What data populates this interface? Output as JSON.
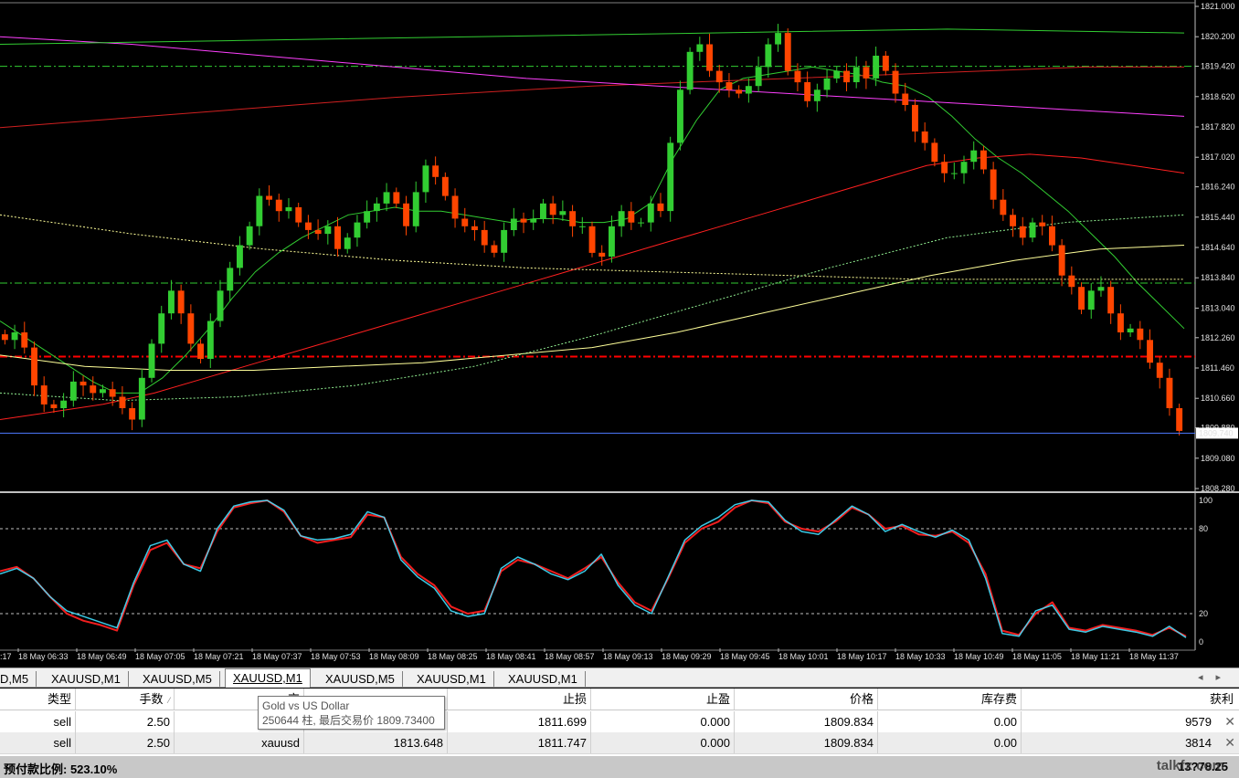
{
  "chart_data": [
    {
      "type": "candlestick",
      "symbol_hint": "XAUUSD,M1",
      "ylim": [
        1808.28,
        1821.0
      ],
      "y_ticks": [
        "1821.000",
        "1820.200",
        "1819.420",
        "1818.620",
        "1817.820",
        "1817.020",
        "1816.240",
        "1815.440",
        "1814.640",
        "1813.840",
        "1813.040",
        "1812.260",
        "1811.460",
        "1810.660",
        "1809.880",
        "1809.080",
        "1808.280"
      ],
      "x_ticks": [
        "18 May 06:33",
        "18 May 06:49",
        "18 May 07:05",
        "18 May 07:21",
        "18 May 07:37",
        "18 May 07:53",
        "18 May 08:09",
        "18 May 08:25",
        "18 May 08:41",
        "18 May 08:57",
        "18 May 09:13",
        "18 May 09:29",
        "18 May 09:45",
        "18 May 10:01",
        "18 May 10:17",
        "18 May 10:33",
        "18 May 10:49",
        "18 May 11:05",
        "18 May 11:21",
        "18 May 11:37"
      ],
      "x_tick_partial_left": ":17",
      "current_price": "1809.740",
      "close_path_approx": [
        1812.2,
        1812.4,
        1812.0,
        1811.0,
        1810.5,
        1810.4,
        1810.6,
        1811.1,
        1811.0,
        1810.8,
        1810.9,
        1810.7,
        1810.4,
        1810.1,
        1811.2,
        1812.1,
        1812.9,
        1813.5,
        1812.9,
        1812.1,
        1811.7,
        1812.7,
        1813.5,
        1814.1,
        1814.7,
        1815.2,
        1816.0,
        1815.9,
        1815.6,
        1815.7,
        1815.3,
        1815.1,
        1815.0,
        1815.2,
        1814.6,
        1814.9,
        1815.3,
        1815.6,
        1815.8,
        1816.1,
        1815.8,
        1815.2,
        1816.1,
        1816.8,
        1816.5,
        1816.0,
        1815.4,
        1815.2,
        1815.1,
        1814.7,
        1814.5,
        1815.1,
        1815.4,
        1815.3,
        1815.4,
        1815.8,
        1815.5,
        1815.6,
        1815.2,
        1815.2,
        1814.5,
        1814.4,
        1815.2,
        1815.6,
        1815.3,
        1815.3,
        1815.8,
        1815.6,
        1817.4,
        1818.8,
        1819.8,
        1820.0,
        1819.3,
        1819.0,
        1818.8,
        1818.7,
        1818.9,
        1819.4,
        1820.0,
        1820.3,
        1819.3,
        1819.0,
        1818.5,
        1818.8,
        1819.1,
        1819.3,
        1819.0,
        1819.4,
        1819.1,
        1819.7,
        1819.3,
        1818.7,
        1818.4,
        1817.7,
        1817.4,
        1816.9,
        1816.6,
        1816.6,
        1816.9,
        1817.2,
        1816.7,
        1815.9,
        1815.5,
        1815.2,
        1814.9,
        1815.3,
        1815.2,
        1814.7,
        1813.9,
        1813.6,
        1813.0,
        1813.5,
        1813.6,
        1812.9,
        1812.4,
        1812.5,
        1812.2,
        1811.6,
        1811.2,
        1810.4,
        1809.8
      ],
      "moving_averages": [
        {
          "color": "#32cd32",
          "style": "solid",
          "values": [
            1812.7,
            1812.3,
            1811.9,
            1811.5,
            1811.1,
            1810.8,
            1810.8,
            1811.2,
            1811.8,
            1812.5,
            1813.3,
            1814.0,
            1814.5,
            1814.9,
            1815.2,
            1815.5,
            1815.6,
            1815.7,
            1815.6,
            1815.6,
            1815.5,
            1815.4,
            1815.3,
            1815.4,
            1815.4,
            1815.3,
            1815.3,
            1815.4,
            1815.8,
            1817.0,
            1818.0,
            1818.8,
            1819.1,
            1819.2,
            1819.3,
            1819.4,
            1819.3,
            1819.2,
            1819.0,
            1818.9,
            1818.6,
            1818.1,
            1817.5,
            1817.0,
            1816.6,
            1816.1,
            1815.6,
            1815.0,
            1814.4,
            1813.7,
            1813.1,
            1812.5
          ]
        },
        {
          "color": "#ff2020",
          "style": "solid",
          "values": [
            1810.1,
            1810.3,
            1810.5,
            1810.8,
            1811.2,
            1811.6,
            1812.0,
            1812.4,
            1812.8,
            1813.2,
            1813.6,
            1814.0,
            1814.4,
            1814.8,
            1815.2,
            1815.6,
            1816.0,
            1816.4,
            1816.8,
            1817.0,
            1817.1,
            1817.0,
            1816.8,
            1816.6
          ]
        },
        {
          "color": "#d02020",
          "style": "solid",
          "values": [
            1817.8,
            1818.0,
            1818.2,
            1818.4,
            1818.6,
            1818.75,
            1818.9,
            1819.0,
            1819.1,
            1819.2,
            1819.3,
            1819.4,
            1819.4
          ]
        },
        {
          "color": "#ff40ff",
          "style": "solid",
          "values": [
            1820.2,
            1820.0,
            1819.7,
            1819.4,
            1819.1,
            1818.9,
            1818.7,
            1818.5,
            1818.3,
            1818.1
          ]
        },
        {
          "color": "#32cd32",
          "style": "solid",
          "values": [
            1820.0,
            1820.1,
            1820.2,
            1820.3,
            1820.4,
            1820.3
          ]
        },
        {
          "color": "#ffff99",
          "style": "solid",
          "values": [
            1811.8,
            1811.5,
            1811.4,
            1811.4,
            1811.5,
            1811.6,
            1811.8,
            1812.0,
            1812.4,
            1812.9,
            1813.4,
            1813.9,
            1814.3,
            1814.6,
            1814.7
          ]
        },
        {
          "color": "#ffff99",
          "style": "dotted",
          "values": [
            1815.5,
            1815.0,
            1814.6,
            1814.3,
            1814.1,
            1814.0,
            1813.9,
            1813.8,
            1813.8,
            1813.8
          ]
        },
        {
          "color": "#90ee90",
          "style": "dotted",
          "values": [
            1810.8,
            1810.6,
            1810.7,
            1811.0,
            1811.5,
            1812.3,
            1813.2,
            1814.1,
            1814.9,
            1815.3,
            1815.5
          ]
        }
      ],
      "levels": [
        {
          "price": 1819.42,
          "color": "#32cd32",
          "style": "dashdot"
        },
        {
          "price": 1813.7,
          "color": "#32cd32",
          "style": "dashdot"
        },
        {
          "price": 1811.76,
          "color": "#ff0000",
          "style": "dashdot"
        }
      ]
    },
    {
      "type": "line",
      "indicator": "stochastic",
      "ylim": [
        0,
        100
      ],
      "y_ticks": [
        "100",
        "80",
        "20",
        "0"
      ],
      "levels": [
        80,
        20
      ],
      "series": [
        {
          "color": "#ff2020",
          "values": [
            50,
            53,
            45,
            32,
            20,
            15,
            12,
            8,
            40,
            65,
            70,
            55,
            52,
            78,
            95,
            98,
            100,
            92,
            75,
            70,
            72,
            74,
            90,
            88,
            60,
            48,
            40,
            25,
            20,
            22,
            50,
            58,
            55,
            50,
            45,
            52,
            60,
            42,
            28,
            22,
            45,
            70,
            80,
            85,
            95,
            100,
            98,
            85,
            80,
            78,
            85,
            95,
            90,
            80,
            82,
            76,
            75,
            78,
            70,
            48,
            8,
            5,
            20,
            28,
            10,
            8,
            12,
            10,
            8,
            5,
            10,
            4
          ]
        },
        {
          "color": "#40e0ff",
          "values": [
            48,
            52,
            45,
            32,
            22,
            18,
            14,
            10,
            42,
            68,
            72,
            55,
            50,
            80,
            96,
            99,
            100,
            93,
            75,
            72,
            73,
            76,
            92,
            88,
            58,
            46,
            38,
            22,
            18,
            20,
            52,
            60,
            55,
            48,
            44,
            50,
            62,
            40,
            26,
            20,
            46,
            72,
            82,
            88,
            97,
            100,
            99,
            86,
            78,
            76,
            86,
            96,
            90,
            78,
            83,
            78,
            74,
            79,
            72,
            45,
            6,
            4,
            22,
            26,
            9,
            7,
            11,
            9,
            7,
            4,
            11,
            3
          ]
        }
      ]
    }
  ],
  "tabs": [
    {
      "label": "D,M5"
    },
    {
      "label": "XAUUSD,M1"
    },
    {
      "label": "XAUUSD,M5"
    },
    {
      "label": "XAUUSD,M1",
      "active": true
    },
    {
      "label": "XAUUSD,M5"
    },
    {
      "label": "XAUUSD,M1"
    },
    {
      "label": "XAUUSD,M1"
    }
  ],
  "table": {
    "headers": {
      "type": "类型",
      "lots": "手数",
      "symbol": "交",
      "open_price": "",
      "stop_loss": "止损",
      "take_profit": "止盈",
      "price": "价格",
      "swap": "库存费",
      "profit": "获利"
    },
    "rows": [
      {
        "type": "sell",
        "lots": "2.50",
        "symbol": "",
        "open_price": "",
        "stop_loss": "1811.699",
        "take_profit": "0.000",
        "price": "1809.834",
        "swap": "0.00",
        "profit": "9579"
      },
      {
        "type": "sell",
        "lots": "2.50",
        "symbol": "xauusd",
        "open_price": "1813.648",
        "stop_loss": "1811.747",
        "take_profit": "0.000",
        "price": "1809.834",
        "swap": "0.00",
        "profit": "3814"
      }
    ]
  },
  "tooltip": {
    "line1": "Gold vs US Dollar",
    "line2": "250644 柱, 最后交易价 1809.73400"
  },
  "status": {
    "margin_level": "预付款比例: 523.10%",
    "total": "13?78.25"
  },
  "watermark": "talkfx.com",
  "colors": {
    "bull": "#32cd32",
    "bear": "#ff4500",
    "grid": "#ffffff",
    "background": "#000000"
  }
}
